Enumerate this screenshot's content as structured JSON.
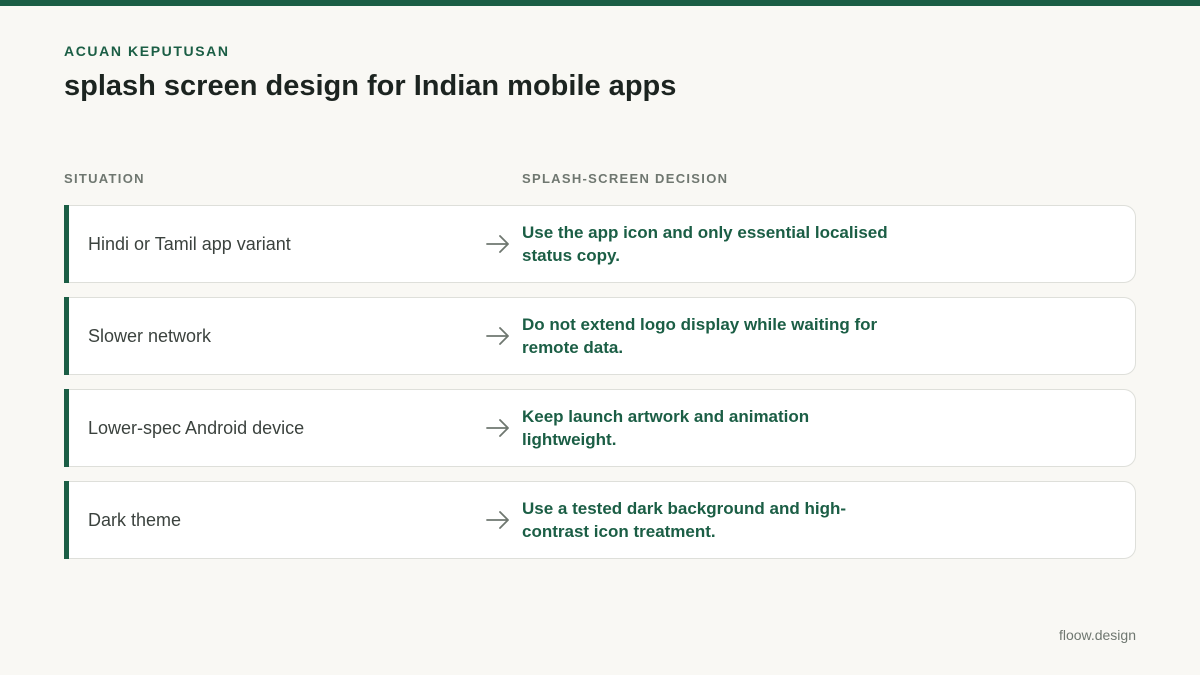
{
  "header": {
    "eyebrow": "ACUAN KEPUTUSAN",
    "title": "splash screen design for Indian mobile apps"
  },
  "columns": {
    "situation": "SITUATION",
    "decision": "SPLASH-SCREEN DECISION"
  },
  "rows": [
    {
      "situation": "Hindi or Tamil app variant",
      "decision": "Use the app icon and only essential localised status copy."
    },
    {
      "situation": "Slower network",
      "decision": "Do not extend logo display while waiting for remote data."
    },
    {
      "situation": "Lower-spec Android device",
      "decision": "Keep launch artwork and animation lightweight."
    },
    {
      "situation": "Dark theme",
      "decision": "Use a tested dark background and high-contrast icon treatment."
    }
  ],
  "footer": {
    "brand": "floow.design"
  },
  "icons": {
    "row_arrow": "right-arrow-icon"
  },
  "colors": {
    "accent": "#1b5e45",
    "background": "#f9f8f4",
    "muted": "#6f7770"
  }
}
